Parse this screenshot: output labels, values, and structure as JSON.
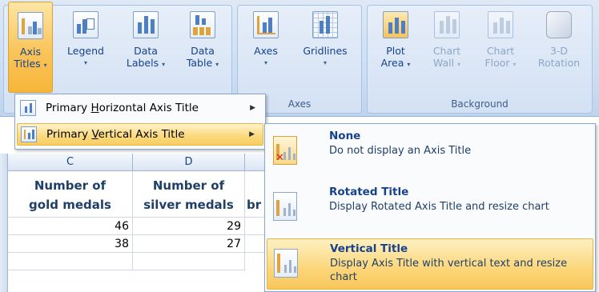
{
  "ribbon": {
    "buttons": [
      {
        "id": "axis-titles",
        "line1": "Axis",
        "line2": "Titles",
        "arrow": "▾"
      },
      {
        "id": "legend",
        "line1": "Legend",
        "line2": "",
        "arrow": "▾"
      },
      {
        "id": "data-labels",
        "line1": "Data",
        "line2": "Labels",
        "arrow": "▾"
      },
      {
        "id": "data-table",
        "line1": "Data",
        "line2": "Table",
        "arrow": "▾"
      },
      {
        "id": "axes",
        "line1": "Axes",
        "line2": "",
        "arrow": "▾"
      },
      {
        "id": "gridlines",
        "line1": "Gridlines",
        "line2": "",
        "arrow": "▾"
      },
      {
        "id": "plot-area",
        "line1": "Plot",
        "line2": "Area",
        "arrow": "▾"
      },
      {
        "id": "chart-wall",
        "line1": "Chart",
        "line2": "Wall",
        "arrow": "▾"
      },
      {
        "id": "chart-floor",
        "line1": "Chart",
        "line2": "Floor",
        "arrow": "▾"
      },
      {
        "id": "rotation",
        "line1": "3-D",
        "line2": "Rotation",
        "arrow": ""
      }
    ],
    "group_axes": "Axes",
    "group_background": "Background"
  },
  "axis_titles_menu": {
    "items": [
      {
        "pre": "Primary ",
        "key": "H",
        "post": "orizontal Axis Title",
        "arrow": "▶"
      },
      {
        "pre": "Primary ",
        "key": "V",
        "post": "ertical Axis Title",
        "arrow": "▶"
      }
    ]
  },
  "vertical_submenu": {
    "items": [
      {
        "title": "None",
        "desc": "Do not display an Axis Title"
      },
      {
        "title": "Rotated Title",
        "desc": "Display Rotated Axis Title and resize chart"
      },
      {
        "title": "Vertical Title",
        "desc": "Display Axis Title with vertical text and resize chart"
      }
    ]
  },
  "sheet": {
    "columns": [
      "C",
      "D"
    ],
    "headers": [
      {
        "line1": "Number of",
        "line2": "gold medals"
      },
      {
        "line1": "Number of",
        "line2": "silver medals"
      }
    ],
    "partial_header": "br",
    "rows": [
      [
        "46",
        "29"
      ],
      [
        "38",
        "27"
      ]
    ]
  }
}
